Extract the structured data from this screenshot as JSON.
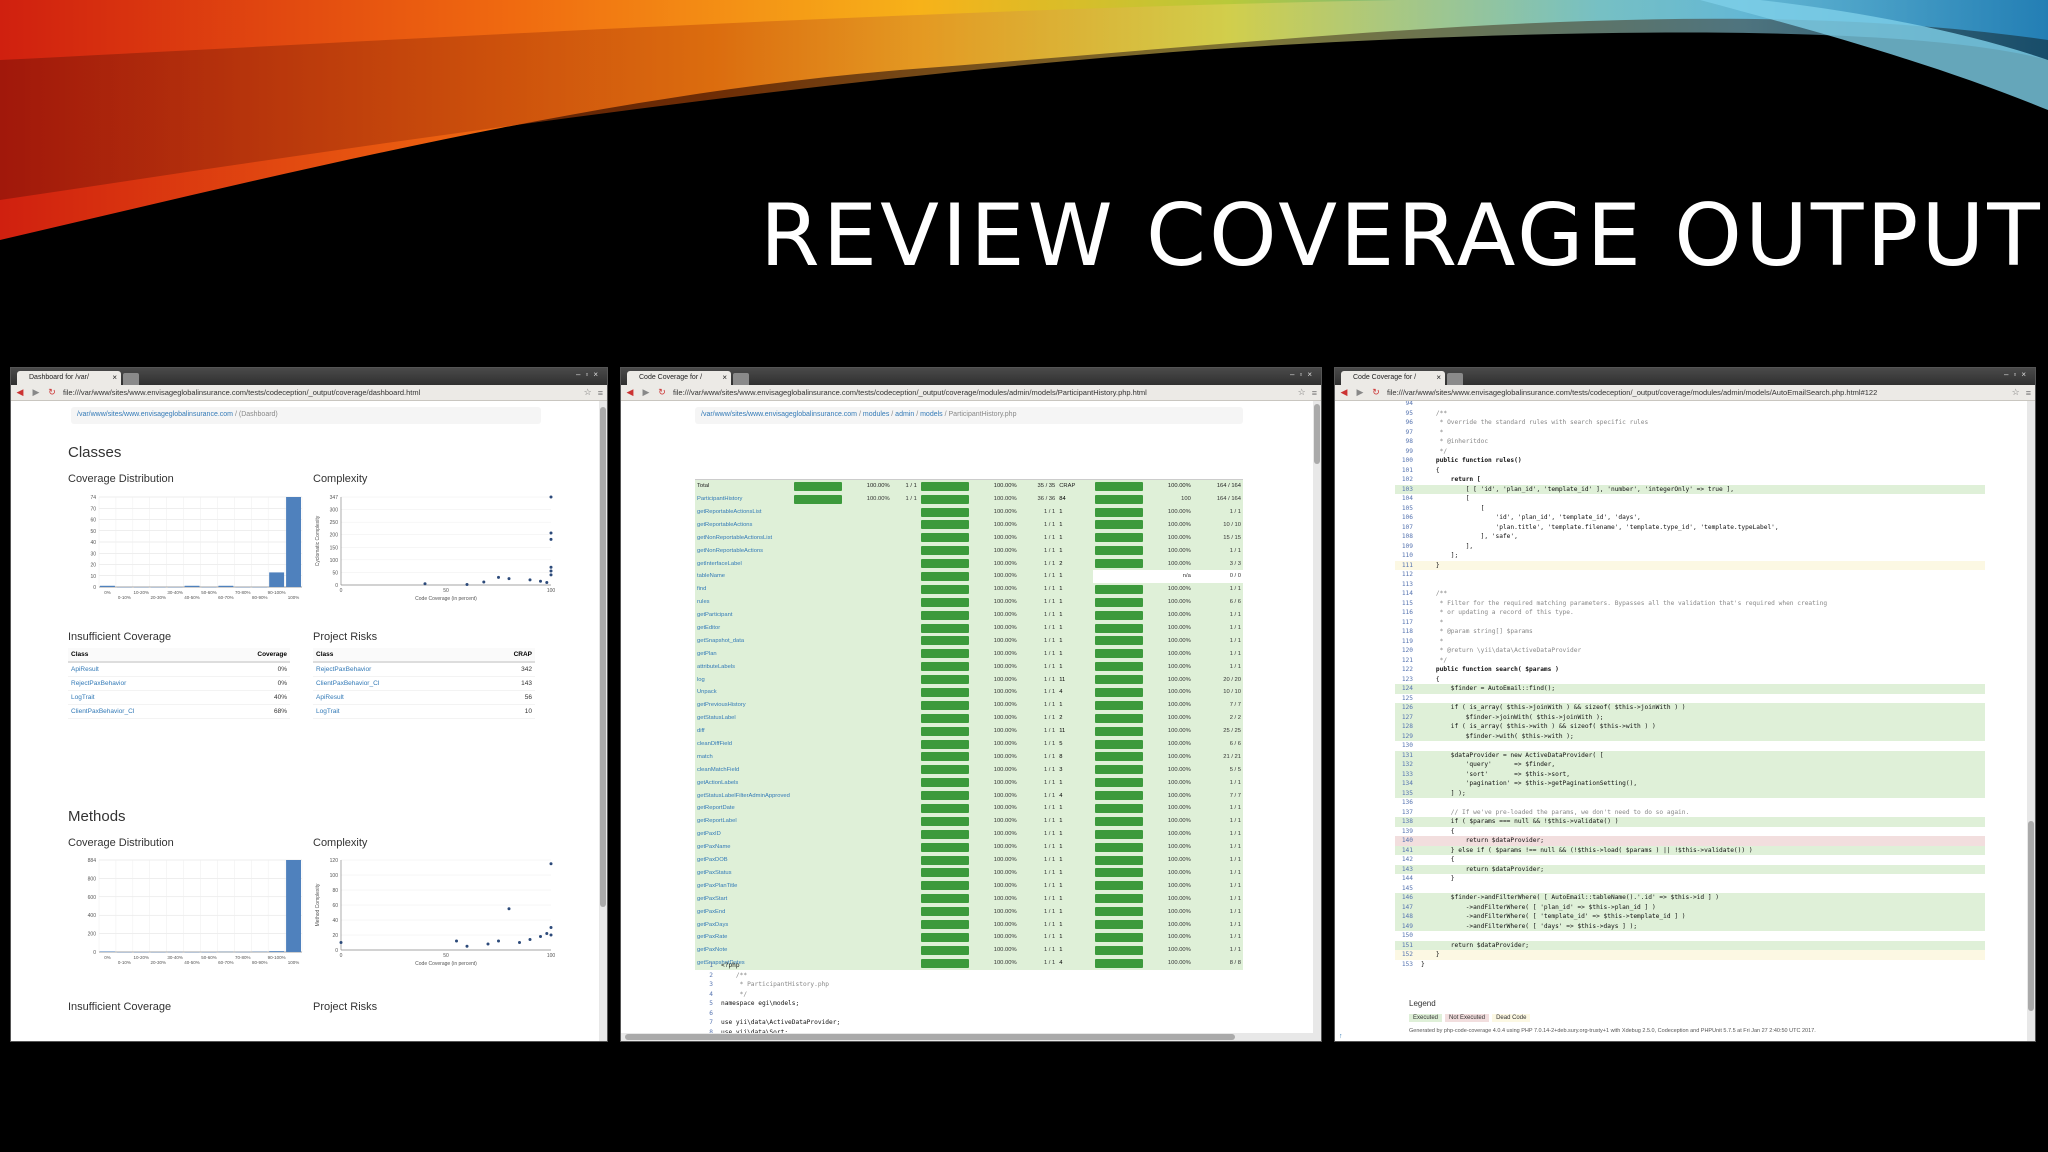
{
  "slide": {
    "title": "REVIEW COVERAGE OUTPUT"
  },
  "browser1": {
    "tab_title": "Dashboard for /var/",
    "url": "file:///var/www/sites/www.envisageglobalinsurance.com/tests/codeception/_output/coverage/dashboard.html",
    "breadcrumb_link": "/var/www/sites/www.envisageglobalinsurance.com",
    "breadcrumb_current": "(Dashboard)",
    "classes_heading": "Classes",
    "methods_heading": "Methods",
    "coverage_distribution": "Coverage Distribution",
    "complexity": "Complexity",
    "insufficient_coverage": "Insufficient Coverage",
    "project_risks": "Project Risks",
    "cov_chart_ylabels": [
      "74",
      "70",
      "60",
      "50",
      "40",
      "30",
      "20",
      "10",
      "0"
    ],
    "cov_chart_xlabels": [
      "0%",
      "0-10%",
      "10-20%",
      "20-30%",
      "30-40%",
      "40-50%",
      "50-60%",
      "60-70%",
      "70-80%",
      "80-90%",
      "90-100%",
      "100%"
    ],
    "cplx_ylabels": [
      "347",
      "300",
      "250",
      "200",
      "150",
      "100",
      "50",
      "0"
    ],
    "cplx_xlabels": [
      "0",
      "50",
      "100"
    ],
    "cplx_ytitle": "Cyclomatic Complexity",
    "cplx_xtitle": "Code Coverage (in percent)",
    "insufficient_table": {
      "headers": [
        "Class",
        "Coverage"
      ],
      "rows": [
        [
          "ApiResult",
          "0%"
        ],
        [
          "RejectPaxBehavior",
          "0%"
        ],
        [
          "LogTrait",
          "40%"
        ],
        [
          "ClientPaxBehavior_CI",
          "68%"
        ]
      ]
    },
    "risks_table": {
      "headers": [
        "Class",
        "CRAP"
      ],
      "rows": [
        [
          "RejectPaxBehavior",
          "342"
        ],
        [
          "ClientPaxBehavior_CI",
          "143"
        ],
        [
          "ApiResult",
          "56"
        ],
        [
          "LogTrait",
          "10"
        ]
      ]
    },
    "m_cov_ylabels": [
      "884",
      "800",
      "600",
      "400",
      "200",
      "0"
    ],
    "m_cplx_ylabels": [
      "120",
      "100",
      "80",
      "60",
      "40",
      "20",
      "0"
    ],
    "m_cplx_ytitle": "Method Complexity"
  },
  "browser2": {
    "tab_title": "Code Coverage for /",
    "url": "file:///var/www/sites/www.envisageglobalinsurance.com/tests/codeception/_output/coverage/modules/admin/models/ParticipantHistory.php.html",
    "breadcrumb": [
      "/var/www/sites/www.envisageglobalinsurance.com",
      "modules",
      "admin",
      "models",
      "ParticipantHistory.php"
    ],
    "table_title": "Code Coverage",
    "groups": [
      "Classes and Traits",
      "Functions and Methods",
      "Lines"
    ],
    "rows": [
      {
        "name": "Total",
        "c_pct": "100.00%",
        "c_ratio": "1 / 1",
        "f_pct": "100.00%",
        "f_ratio": "35 / 35",
        "crap": "CRAP",
        "l_pct": "100.00%",
        "l_ratio": "164 / 164"
      },
      {
        "name": "ParticipantHistory",
        "c_pct": "100.00%",
        "c_ratio": "1 / 1",
        "f_pct": "100.00%",
        "f_ratio": "36 / 36",
        "crap": "84",
        "l_pct": "100",
        "l_ratio": "164 / 164"
      },
      {
        "name": "getReportableActionsList",
        "f_pct": "100.00%",
        "f_ratio": "1 / 1",
        "crap": "1",
        "l_pct": "100.00%",
        "l_ratio": "1 / 1"
      },
      {
        "name": "getReportableActions",
        "f_pct": "100.00%",
        "f_ratio": "1 / 1",
        "crap": "1",
        "l_pct": "100.00%",
        "l_ratio": "10 / 10"
      },
      {
        "name": "getNonReportableActionsList",
        "f_pct": "100.00%",
        "f_ratio": "1 / 1",
        "crap": "1",
        "l_pct": "100.00%",
        "l_ratio": "15 / 15"
      },
      {
        "name": "getNonReportableActions",
        "f_pct": "100.00%",
        "f_ratio": "1 / 1",
        "crap": "1",
        "l_pct": "100.00%",
        "l_ratio": "1 / 1"
      },
      {
        "name": "getInterfaceLabel",
        "f_pct": "100.00%",
        "f_ratio": "1 / 1",
        "crap": "2",
        "l_pct": "100.00%",
        "l_ratio": "3 / 3"
      },
      {
        "name": "tableName",
        "f_pct": "100.00%",
        "f_ratio": "1 / 1",
        "crap": "1",
        "l_pct": "n/a",
        "l_ratio": "0 / 0",
        "empty": true
      },
      {
        "name": "find",
        "f_pct": "100.00%",
        "f_ratio": "1 / 1",
        "crap": "1",
        "l_pct": "100.00%",
        "l_ratio": "1 / 1"
      },
      {
        "name": "rules",
        "f_pct": "100.00%",
        "f_ratio": "1 / 1",
        "crap": "1",
        "l_pct": "100.00%",
        "l_ratio": "6 / 6"
      },
      {
        "name": "getParticipant",
        "f_pct": "100.00%",
        "f_ratio": "1 / 1",
        "crap": "1",
        "l_pct": "100.00%",
        "l_ratio": "1 / 1"
      },
      {
        "name": "getEditor",
        "f_pct": "100.00%",
        "f_ratio": "1 / 1",
        "crap": "1",
        "l_pct": "100.00%",
        "l_ratio": "1 / 1"
      },
      {
        "name": "getSnapshot_data",
        "f_pct": "100.00%",
        "f_ratio": "1 / 1",
        "crap": "1",
        "l_pct": "100.00%",
        "l_ratio": "1 / 1"
      },
      {
        "name": "getPlan",
        "f_pct": "100.00%",
        "f_ratio": "1 / 1",
        "crap": "1",
        "l_pct": "100.00%",
        "l_ratio": "1 / 1"
      },
      {
        "name": "attributeLabels",
        "f_pct": "100.00%",
        "f_ratio": "1 / 1",
        "crap": "1",
        "l_pct": "100.00%",
        "l_ratio": "1 / 1"
      },
      {
        "name": "log",
        "f_pct": "100.00%",
        "f_ratio": "1 / 1",
        "crap": "11",
        "l_pct": "100.00%",
        "l_ratio": "20 / 20"
      },
      {
        "name": "Unpack",
        "f_pct": "100.00%",
        "f_ratio": "1 / 1",
        "crap": "4",
        "l_pct": "100.00%",
        "l_ratio": "10 / 10"
      },
      {
        "name": "getPreviousHistory",
        "f_pct": "100.00%",
        "f_ratio": "1 / 1",
        "crap": "1",
        "l_pct": "100.00%",
        "l_ratio": "7 / 7"
      },
      {
        "name": "getStatusLabel",
        "f_pct": "100.00%",
        "f_ratio": "1 / 1",
        "crap": "2",
        "l_pct": "100.00%",
        "l_ratio": "2 / 2"
      },
      {
        "name": "diff",
        "f_pct": "100.00%",
        "f_ratio": "1 / 1",
        "crap": "11",
        "l_pct": "100.00%",
        "l_ratio": "25 / 25"
      },
      {
        "name": "cleanDiffField",
        "f_pct": "100.00%",
        "f_ratio": "1 / 1",
        "crap": "5",
        "l_pct": "100.00%",
        "l_ratio": "6 / 6"
      },
      {
        "name": "match",
        "f_pct": "100.00%",
        "f_ratio": "1 / 1",
        "crap": "8",
        "l_pct": "100.00%",
        "l_ratio": "21 / 21"
      },
      {
        "name": "cleanMatchField",
        "f_pct": "100.00%",
        "f_ratio": "1 / 1",
        "crap": "3",
        "l_pct": "100.00%",
        "l_ratio": "5 / 5"
      },
      {
        "name": "getActionLabels",
        "f_pct": "100.00%",
        "f_ratio": "1 / 1",
        "crap": "1",
        "l_pct": "100.00%",
        "l_ratio": "1 / 1"
      },
      {
        "name": "getStatusLabelFilterAdminApproved",
        "f_pct": "100.00%",
        "f_ratio": "1 / 1",
        "crap": "4",
        "l_pct": "100.00%",
        "l_ratio": "7 / 7"
      },
      {
        "name": "getReportDate",
        "f_pct": "100.00%",
        "f_ratio": "1 / 1",
        "crap": "1",
        "l_pct": "100.00%",
        "l_ratio": "1 / 1"
      },
      {
        "name": "getReportLabel",
        "f_pct": "100.00%",
        "f_ratio": "1 / 1",
        "crap": "1",
        "l_pct": "100.00%",
        "l_ratio": "1 / 1"
      },
      {
        "name": "getPaxID",
        "f_pct": "100.00%",
        "f_ratio": "1 / 1",
        "crap": "1",
        "l_pct": "100.00%",
        "l_ratio": "1 / 1"
      },
      {
        "name": "getPaxName",
        "f_pct": "100.00%",
        "f_ratio": "1 / 1",
        "crap": "1",
        "l_pct": "100.00%",
        "l_ratio": "1 / 1"
      },
      {
        "name": "getPaxDOB",
        "f_pct": "100.00%",
        "f_ratio": "1 / 1",
        "crap": "1",
        "l_pct": "100.00%",
        "l_ratio": "1 / 1"
      },
      {
        "name": "getPaxStatus",
        "f_pct": "100.00%",
        "f_ratio": "1 / 1",
        "crap": "1",
        "l_pct": "100.00%",
        "l_ratio": "1 / 1"
      },
      {
        "name": "getPaxPlanTitle",
        "f_pct": "100.00%",
        "f_ratio": "1 / 1",
        "crap": "1",
        "l_pct": "100.00%",
        "l_ratio": "1 / 1"
      },
      {
        "name": "getPaxStart",
        "f_pct": "100.00%",
        "f_ratio": "1 / 1",
        "crap": "1",
        "l_pct": "100.00%",
        "l_ratio": "1 / 1"
      },
      {
        "name": "getPaxEnd",
        "f_pct": "100.00%",
        "f_ratio": "1 / 1",
        "crap": "1",
        "l_pct": "100.00%",
        "l_ratio": "1 / 1"
      },
      {
        "name": "getPaxDays",
        "f_pct": "100.00%",
        "f_ratio": "1 / 1",
        "crap": "1",
        "l_pct": "100.00%",
        "l_ratio": "1 / 1"
      },
      {
        "name": "getPaxRate",
        "f_pct": "100.00%",
        "f_ratio": "1 / 1",
        "crap": "1",
        "l_pct": "100.00%",
        "l_ratio": "1 / 1"
      },
      {
        "name": "getPaxNote",
        "f_pct": "100.00%",
        "f_ratio": "1 / 1",
        "crap": "1",
        "l_pct": "100.00%",
        "l_ratio": "1 / 1"
      },
      {
        "name": "getSnapshotDates",
        "f_pct": "100.00%",
        "f_ratio": "1 / 1",
        "crap": "4",
        "l_pct": "100.00%",
        "l_ratio": "8 / 8"
      }
    ],
    "code": [
      {
        "n": "1",
        "t": "<?php"
      },
      {
        "n": "2",
        "t": "    /**",
        "c": "cm"
      },
      {
        "n": "3",
        "t": "     * ParticipantHistory.php",
        "c": "cm"
      },
      {
        "n": "4",
        "t": "     */",
        "c": "cm"
      },
      {
        "n": "5",
        "t": "namespace egi\\models;"
      },
      {
        "n": "6",
        "t": ""
      },
      {
        "n": "7",
        "t": "use yii\\data\\ActiveDataProvider;"
      },
      {
        "n": "8",
        "t": "use yii\\data\\Sort;"
      }
    ]
  },
  "browser3": {
    "tab_title": "Code Coverage for /",
    "url": "file:///var/www/sites/www.envisageglobalinsurance.com/tests/codeception/_output/coverage/modules/admin/models/AutoEmailSearch.php.html#122",
    "code": [
      {
        "n": "94",
        "t": ""
      },
      {
        "n": "95",
        "t": "    /**",
        "c": "cm"
      },
      {
        "n": "96",
        "t": "     * Override the standard rules with search specific rules",
        "c": "cm"
      },
      {
        "n": "97",
        "t": "     *",
        "c": "cm"
      },
      {
        "n": "98",
        "t": "     * @inheritdoc",
        "c": "cm"
      },
      {
        "n": "99",
        "t": "     */",
        "c": "cm"
      },
      {
        "n": "100",
        "t": "    public function rules()",
        "c": "kw"
      },
      {
        "n": "101",
        "t": "    {"
      },
      {
        "n": "102",
        "t": "        return [",
        "c": "kw"
      },
      {
        "n": "103",
        "t": "            [ [ 'id', 'plan_id', 'template_id' ], 'number', 'integerOnly' => true ],",
        "s": "ex"
      },
      {
        "n": "104",
        "t": "            ["
      },
      {
        "n": "105",
        "t": "                ["
      },
      {
        "n": "106",
        "t": "                    'id', 'plan_id', 'template_id', 'days',"
      },
      {
        "n": "107",
        "t": "                    'plan.title', 'template.filename', 'template.type_id', 'template.typeLabel',"
      },
      {
        "n": "108",
        "t": "                ], 'safe',"
      },
      {
        "n": "109",
        "t": "            ],"
      },
      {
        "n": "110",
        "t": "        ];"
      },
      {
        "n": "111",
        "t": "    }",
        "s": "dc"
      },
      {
        "n": "112",
        "t": ""
      },
      {
        "n": "113",
        "t": ""
      },
      {
        "n": "114",
        "t": "    /**",
        "c": "cm"
      },
      {
        "n": "115",
        "t": "     * Filter for the required matching parameters. Bypasses all the validation that's required when creating",
        "c": "cm"
      },
      {
        "n": "116",
        "t": "     * or updating a record of this type.",
        "c": "cm"
      },
      {
        "n": "117",
        "t": "     *",
        "c": "cm"
      },
      {
        "n": "118",
        "t": "     * @param string[] $params",
        "c": "cm"
      },
      {
        "n": "119",
        "t": "     *",
        "c": "cm"
      },
      {
        "n": "120",
        "t": "     * @return \\yii\\data\\ActiveDataProvider",
        "c": "cm"
      },
      {
        "n": "121",
        "t": "     */",
        "c": "cm"
      },
      {
        "n": "122",
        "t": "    public function search( $params )",
        "c": "kw"
      },
      {
        "n": "123",
        "t": "    {"
      },
      {
        "n": "124",
        "t": "        $finder = AutoEmail::find();",
        "s": "ex"
      },
      {
        "n": "125",
        "t": ""
      },
      {
        "n": "126",
        "t": "        if ( is_array( $this->joinWith ) && sizeof( $this->joinWith ) )",
        "s": "ex"
      },
      {
        "n": "127",
        "t": "            $finder->joinWith( $this->joinWith );",
        "s": "ex"
      },
      {
        "n": "128",
        "t": "        if ( is_array( $this->with ) && sizeof( $this->with ) )",
        "s": "ex"
      },
      {
        "n": "129",
        "t": "            $finder->with( $this->with );",
        "s": "ex"
      },
      {
        "n": "130",
        "t": ""
      },
      {
        "n": "131",
        "t": "        $dataProvider = new ActiveDataProvider( [",
        "s": "ex"
      },
      {
        "n": "132",
        "t": "            'query'      => $finder,",
        "s": "ex"
      },
      {
        "n": "133",
        "t": "            'sort'       => $this->sort,",
        "s": "ex"
      },
      {
        "n": "134",
        "t": "            'pagination' => $this->getPaginationSetting(),",
        "s": "ex"
      },
      {
        "n": "135",
        "t": "        ] );",
        "s": "ex"
      },
      {
        "n": "136",
        "t": ""
      },
      {
        "n": "137",
        "t": "        // If we've pre-loaded the params, we don't need to do so again.",
        "c": "cm"
      },
      {
        "n": "138",
        "t": "        if ( $params === null && !$this->validate() )",
        "s": "ex"
      },
      {
        "n": "139",
        "t": "        {"
      },
      {
        "n": "140",
        "t": "            return $dataProvider;",
        "s": "ne"
      },
      {
        "n": "141",
        "t": "        } else if ( $params !== null && (!$this->load( $params ) || !$this->validate()) )",
        "s": "ex"
      },
      {
        "n": "142",
        "t": "        {"
      },
      {
        "n": "143",
        "t": "            return $dataProvider;",
        "s": "ex"
      },
      {
        "n": "144",
        "t": "        }"
      },
      {
        "n": "145",
        "t": ""
      },
      {
        "n": "146",
        "t": "        $finder->andFilterWhere( [ AutoEmail::tableName().'.id' => $this->id ] )",
        "s": "ex"
      },
      {
        "n": "147",
        "t": "            ->andFilterWhere( [ 'plan_id' => $this->plan_id ] )",
        "s": "ex"
      },
      {
        "n": "148",
        "t": "            ->andFilterWhere( [ 'template_id' => $this->template_id ] )",
        "s": "ex"
      },
      {
        "n": "149",
        "t": "            ->andFilterWhere( [ 'days' => $this->days ] );",
        "s": "ex"
      },
      {
        "n": "150",
        "t": ""
      },
      {
        "n": "151",
        "t": "        return $dataProvider;",
        "s": "ex"
      },
      {
        "n": "152",
        "t": "    }",
        "s": "dc"
      },
      {
        "n": "153",
        "t": "}"
      }
    ],
    "legend_title": "Legend",
    "legend_items": [
      "Executed",
      "Not Executed",
      "Dead Code"
    ],
    "footer": "Generated by php-code-coverage 4.0.4 using PHP 7.0.14-2+deb.sury.org-trusty+1 with Xdebug 2.5.0, Codeception and PHPUnit 5.7.5 at Fri Jan 27 2:40:50 UTC 2017."
  },
  "colors": {
    "executed": "#dff0d8",
    "not_executed": "#f2dede",
    "dead_code": "#fcf8e3",
    "bar_blue": "#4f81bd",
    "bar_green": "#3c9a3c"
  },
  "chart_data": [
    {
      "type": "bar",
      "title": "Coverage Distribution",
      "categories": [
        "0%",
        "0-10%",
        "10-20%",
        "20-30%",
        "30-40%",
        "40-50%",
        "50-60%",
        "60-70%",
        "70-80%",
        "80-90%",
        "90-100%",
        "100%"
      ],
      "values": [
        1,
        0,
        0,
        0,
        0,
        1,
        0,
        1,
        0,
        0,
        12,
        74
      ],
      "ylim": [
        0,
        74
      ]
    },
    {
      "type": "scatter",
      "title": "Complexity",
      "xlabel": "Code Coverage (in percent)",
      "ylabel": "Cyclomatic Complexity",
      "xlim": [
        0,
        100
      ],
      "ylim": [
        0,
        347
      ],
      "x": [
        100,
        100,
        100,
        40,
        68,
        75,
        80,
        90,
        95,
        98,
        100,
        100,
        100,
        60
      ],
      "y": [
        347,
        205,
        180,
        5,
        12,
        30,
        25,
        20,
        15,
        10,
        40,
        55,
        70,
        2
      ]
    },
    {
      "type": "bar",
      "title": "Coverage Distribution",
      "categories": [
        "0%",
        "0-10%",
        "10-20%",
        "20-30%",
        "30-40%",
        "40-50%",
        "50-60%",
        "60-70%",
        "70-80%",
        "80-90%",
        "90-100%",
        "100%"
      ],
      "values": [
        5,
        0,
        0,
        0,
        1,
        0,
        0,
        2,
        1,
        3,
        8,
        884
      ],
      "ylim": [
        0,
        884
      ]
    },
    {
      "type": "scatter",
      "title": "Complexity",
      "xlabel": "Code Coverage (in percent)",
      "ylabel": "Method Complexity",
      "xlim": [
        0,
        100
      ],
      "ylim": [
        0,
        120
      ],
      "x": [
        0,
        100,
        80,
        55,
        70,
        85,
        90,
        95,
        98,
        100,
        100,
        60,
        75
      ],
      "y": [
        10,
        115,
        55,
        12,
        8,
        10,
        14,
        18,
        22,
        30,
        20,
        5,
        12
      ]
    }
  ]
}
